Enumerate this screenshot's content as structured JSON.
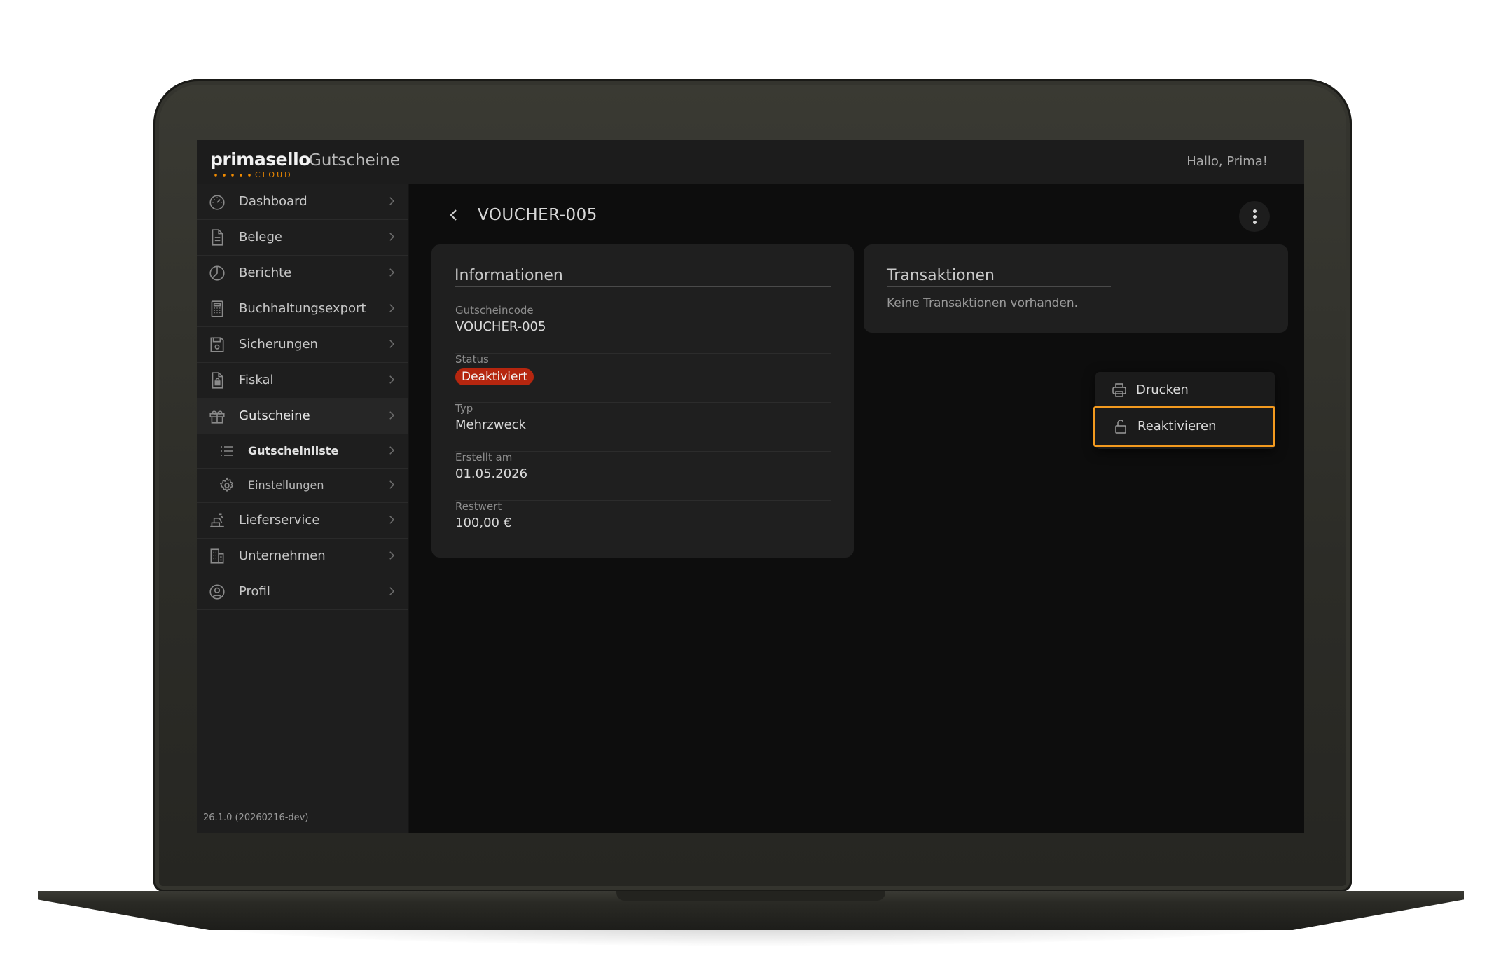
{
  "header": {
    "logo_text": "primasello",
    "logo_sub": "CLOUD",
    "app_title": "Gutscheine",
    "greeting": "Hallo, Prima!"
  },
  "sidebar": {
    "items": [
      {
        "label": "Dashboard",
        "icon": "gauge-icon"
      },
      {
        "label": "Belege",
        "icon": "document-icon"
      },
      {
        "label": "Berichte",
        "icon": "pie-chart-icon"
      },
      {
        "label": "Buchhaltungsexport",
        "icon": "calculator-icon"
      },
      {
        "label": "Sicherungen",
        "icon": "save-icon"
      },
      {
        "label": "Fiskal",
        "icon": "document-lock-icon"
      },
      {
        "label": "Gutscheine",
        "icon": "gift-icon"
      },
      {
        "label": "Lieferservice",
        "icon": "delivery-icon"
      },
      {
        "label": "Unternehmen",
        "icon": "building-icon"
      },
      {
        "label": "Profil",
        "icon": "user-circle-icon"
      }
    ],
    "sub_items": [
      {
        "label": "Gutscheinliste",
        "icon": "list-icon"
      },
      {
        "label": "Einstellungen",
        "icon": "gear-icon"
      }
    ],
    "version": "26.1.0 (20260216-dev)"
  },
  "main": {
    "title": "VOUCHER-005",
    "info_card": {
      "title": "Informationen",
      "fields": [
        {
          "label": "Gutscheincode",
          "value": "VOUCHER-005"
        },
        {
          "label": "Status",
          "value": "Deaktiviert"
        },
        {
          "label": "Typ",
          "value": "Mehrzweck"
        },
        {
          "label": "Erstellt am",
          "value": "01.05.2026"
        },
        {
          "label": "Restwert",
          "value": "100,00 €"
        }
      ]
    },
    "transactions_card": {
      "title": "Transaktionen",
      "empty_text": "Keine Transaktionen vorhanden."
    }
  },
  "menu": {
    "items": [
      {
        "label": "Drucken",
        "icon": "printer-icon"
      },
      {
        "label": "Reaktivieren",
        "icon": "unlock-icon"
      }
    ]
  },
  "colors": {
    "accent": "#f08a00",
    "highlight": "#f39a1f",
    "badge_red": "#b5260f"
  }
}
